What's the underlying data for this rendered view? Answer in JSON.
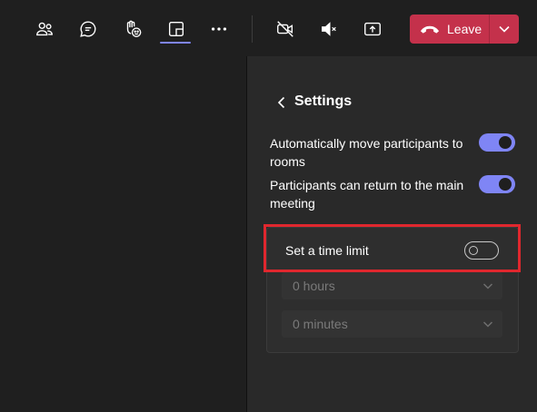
{
  "toolbar": {
    "icons": [
      "people-icon",
      "chat-icon",
      "reactions-icon",
      "rooms-icon",
      "more-icon",
      "camera-off-icon",
      "mic-muted-icon",
      "share-icon"
    ],
    "leave_label": "Leave"
  },
  "settings": {
    "title": "Settings",
    "auto_move": {
      "label": "Automatically move participants to rooms",
      "enabled": true
    },
    "can_return": {
      "label": "Participants can return to the main meeting",
      "enabled": true
    },
    "time_limit": {
      "label": "Set a time limit",
      "enabled": false
    },
    "hours_select": {
      "value": "0 hours"
    },
    "minutes_select": {
      "value": "0 minutes"
    }
  },
  "colors": {
    "accent": "#7f85f5",
    "leave": "#c4314b",
    "highlight": "#e0272e",
    "panel": "#292929",
    "background": "#1f1f1f"
  }
}
